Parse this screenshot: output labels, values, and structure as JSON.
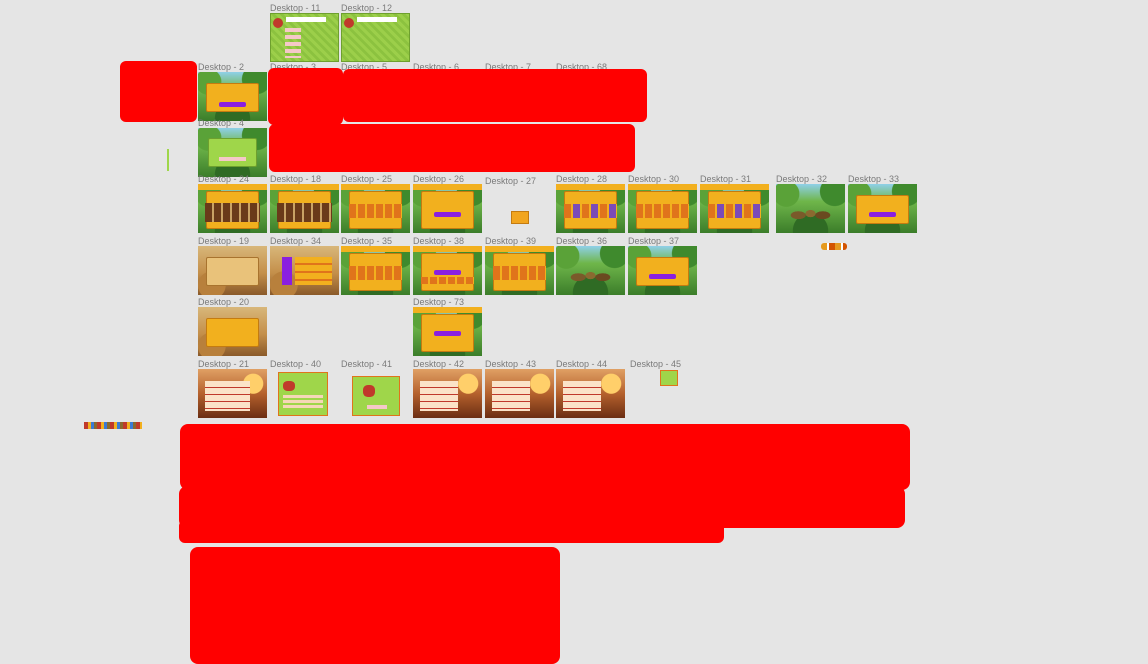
{
  "canvas": {
    "background": "#e5e5e5",
    "redaction_color": "#ff0000",
    "label_color": "#7a7a7a"
  },
  "frames": [
    {
      "id": "d11",
      "label": "Desktop - 11",
      "style": "grass"
    },
    {
      "id": "d12",
      "label": "Desktop - 12",
      "style": "grass"
    },
    {
      "id": "d2",
      "label": "Desktop - 2",
      "style": "jungle"
    },
    {
      "id": "d3",
      "label": "Desktop - 3",
      "style": "jungle"
    },
    {
      "id": "d5",
      "label": "Desktop - 5",
      "style": "jungle"
    },
    {
      "id": "d6",
      "label": "Desktop - 6",
      "style": "jungle"
    },
    {
      "id": "d7",
      "label": "Desktop - 7",
      "style": "jungle"
    },
    {
      "id": "d68",
      "label": "Desktop - 68",
      "style": "jungle"
    },
    {
      "id": "d4",
      "label": "Desktop - 4",
      "style": "jungle"
    },
    {
      "id": "d24",
      "label": "Desktop - 24",
      "style": "jungle"
    },
    {
      "id": "d18",
      "label": "Desktop - 18",
      "style": "jungle"
    },
    {
      "id": "d25",
      "label": "Desktop - 25",
      "style": "jungle"
    },
    {
      "id": "d26",
      "label": "Desktop - 26",
      "style": "jungle"
    },
    {
      "id": "d27",
      "label": "Desktop - 27",
      "style": "empty"
    },
    {
      "id": "d28",
      "label": "Desktop - 28",
      "style": "jungle"
    },
    {
      "id": "d30",
      "label": "Desktop - 30",
      "style": "jungle"
    },
    {
      "id": "d31",
      "label": "Desktop - 31",
      "style": "jungle"
    },
    {
      "id": "d32",
      "label": "Desktop - 32",
      "style": "jungle"
    },
    {
      "id": "d33",
      "label": "Desktop - 33",
      "style": "jungle"
    },
    {
      "id": "d19",
      "label": "Desktop - 19",
      "style": "desert"
    },
    {
      "id": "d34",
      "label": "Desktop - 34",
      "style": "desert"
    },
    {
      "id": "d35",
      "label": "Desktop - 35",
      "style": "jungle"
    },
    {
      "id": "d38",
      "label": "Desktop - 38",
      "style": "jungle"
    },
    {
      "id": "d39",
      "label": "Desktop - 39",
      "style": "jungle"
    },
    {
      "id": "d36",
      "label": "Desktop - 36",
      "style": "jungle"
    },
    {
      "id": "d37",
      "label": "Desktop - 37",
      "style": "jungle"
    },
    {
      "id": "d20",
      "label": "Desktop - 20",
      "style": "desert"
    },
    {
      "id": "d73",
      "label": "Desktop - 73",
      "style": "jungle"
    },
    {
      "id": "d21",
      "label": "Desktop - 21",
      "style": "ember"
    },
    {
      "id": "d40",
      "label": "Desktop - 40",
      "style": "plain"
    },
    {
      "id": "d41",
      "label": "Desktop - 41",
      "style": "plain"
    },
    {
      "id": "d42",
      "label": "Desktop - 42",
      "style": "ember"
    },
    {
      "id": "d43",
      "label": "Desktop - 43",
      "style": "ember"
    },
    {
      "id": "d44",
      "label": "Desktop - 44",
      "style": "ember"
    },
    {
      "id": "d45",
      "label": "Desktop - 45",
      "style": "plain"
    }
  ],
  "redactions_count": 7,
  "assets": {
    "emoji_strip": "emoji-strip",
    "tiny_icons": "coin-icons"
  }
}
